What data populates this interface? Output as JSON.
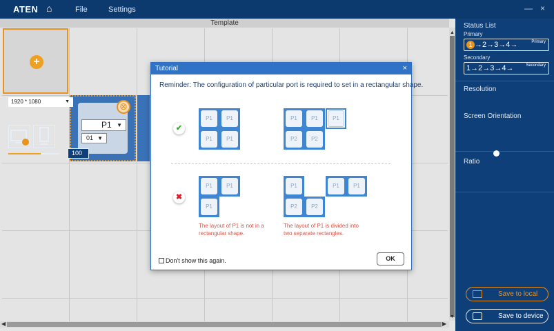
{
  "app": {
    "logo": "ATEN",
    "menu": [
      "File",
      "Settings"
    ],
    "window_controls": {
      "minimize": "—",
      "close": "×"
    }
  },
  "workspace": {
    "title": "Template",
    "add_icon": "+",
    "port_select": {
      "value": "P1"
    },
    "sub_select": {
      "value": "01"
    }
  },
  "panel": {
    "status_list": "Status List",
    "primary_label": "Primary",
    "primary_tag": "Primary",
    "secondary_label": "Secondary",
    "secondary_tag": "Secondary",
    "sequence": [
      "1",
      "2",
      "3",
      "4"
    ],
    "resolution_label": "Resolution",
    "resolution_value": "1920 * 1080",
    "orientation_label": "Screen Orientation",
    "orientation_selected": "landscape",
    "ratio_label": "Ratio",
    "ratio_value": "100",
    "ratio_fraction": 0.63,
    "save_local": "Save to local",
    "save_device": "Save to device"
  },
  "modal": {
    "title": "Tutorial",
    "close_icon": "×",
    "reminder": "Reminder: The configuration of particular port is required to set in a rectangular shape.",
    "good_icon": "✔",
    "bad_icon": "✖",
    "good_a": [
      "P1",
      "P1",
      "P1",
      "P1"
    ],
    "good_b": [
      "P1",
      "P1",
      "P1",
      "P2",
      "P2"
    ],
    "bad_a": [
      "P1",
      "P1",
      "P1"
    ],
    "bad_b": [
      "P1",
      "P1",
      "P1",
      "P2",
      "P2"
    ],
    "error_a": "The layout of P1 is not in a rectangular shape.",
    "error_b": "The layout of P1 is divided into two separate rectangles.",
    "dont_show": "Don't show this again.",
    "ok": "OK"
  },
  "colors": {
    "panel_bg": "#0f3f78",
    "topbar_bg": "#0d3a6e",
    "accent_orange": "#e8921f",
    "tile_blue": "#3f86d2",
    "error_red": "#d2574a"
  }
}
